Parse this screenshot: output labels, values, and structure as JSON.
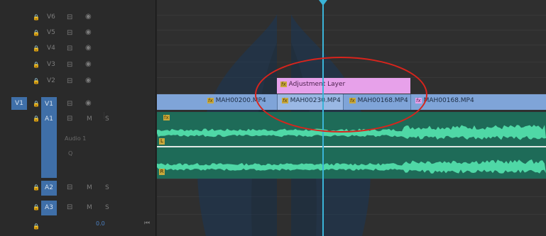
{
  "header": {
    "tracks": [
      {
        "name": "V6"
      },
      {
        "name": "V5"
      },
      {
        "name": "V4"
      },
      {
        "name": "V3"
      },
      {
        "name": "V2"
      },
      {
        "name": "V1",
        "source": "V1"
      },
      {
        "name": "A1",
        "label": "Audio 1",
        "m": "M",
        "s": "S",
        "q": "Q"
      },
      {
        "name": "A2",
        "m": "M",
        "s": "S"
      },
      {
        "name": "A3",
        "m": "M",
        "s": "S"
      }
    ],
    "volume": "0.0",
    "icons": [
      "lock-icon",
      "sync-icon",
      "eye-icon",
      "end-icon"
    ]
  },
  "clips": {
    "adjustment": "Adjustment Layer",
    "video": [
      "MAH00200.MP4",
      "MAH00230.MP4",
      "MAH00168.MP4",
      "MAH00168.MP4"
    ],
    "fx": "fx",
    "left_channel": "L",
    "right_channel": "R"
  },
  "colors": {
    "track_highlight": "#3f6fa8",
    "video_clip": "#7fa4d8",
    "adjustment_clip": "#e7a1ea",
    "audio_clip": "#1e6b58",
    "waveform": "#4fd8a6",
    "playhead": "#3ab4d8",
    "annotation": "#d9241c"
  }
}
